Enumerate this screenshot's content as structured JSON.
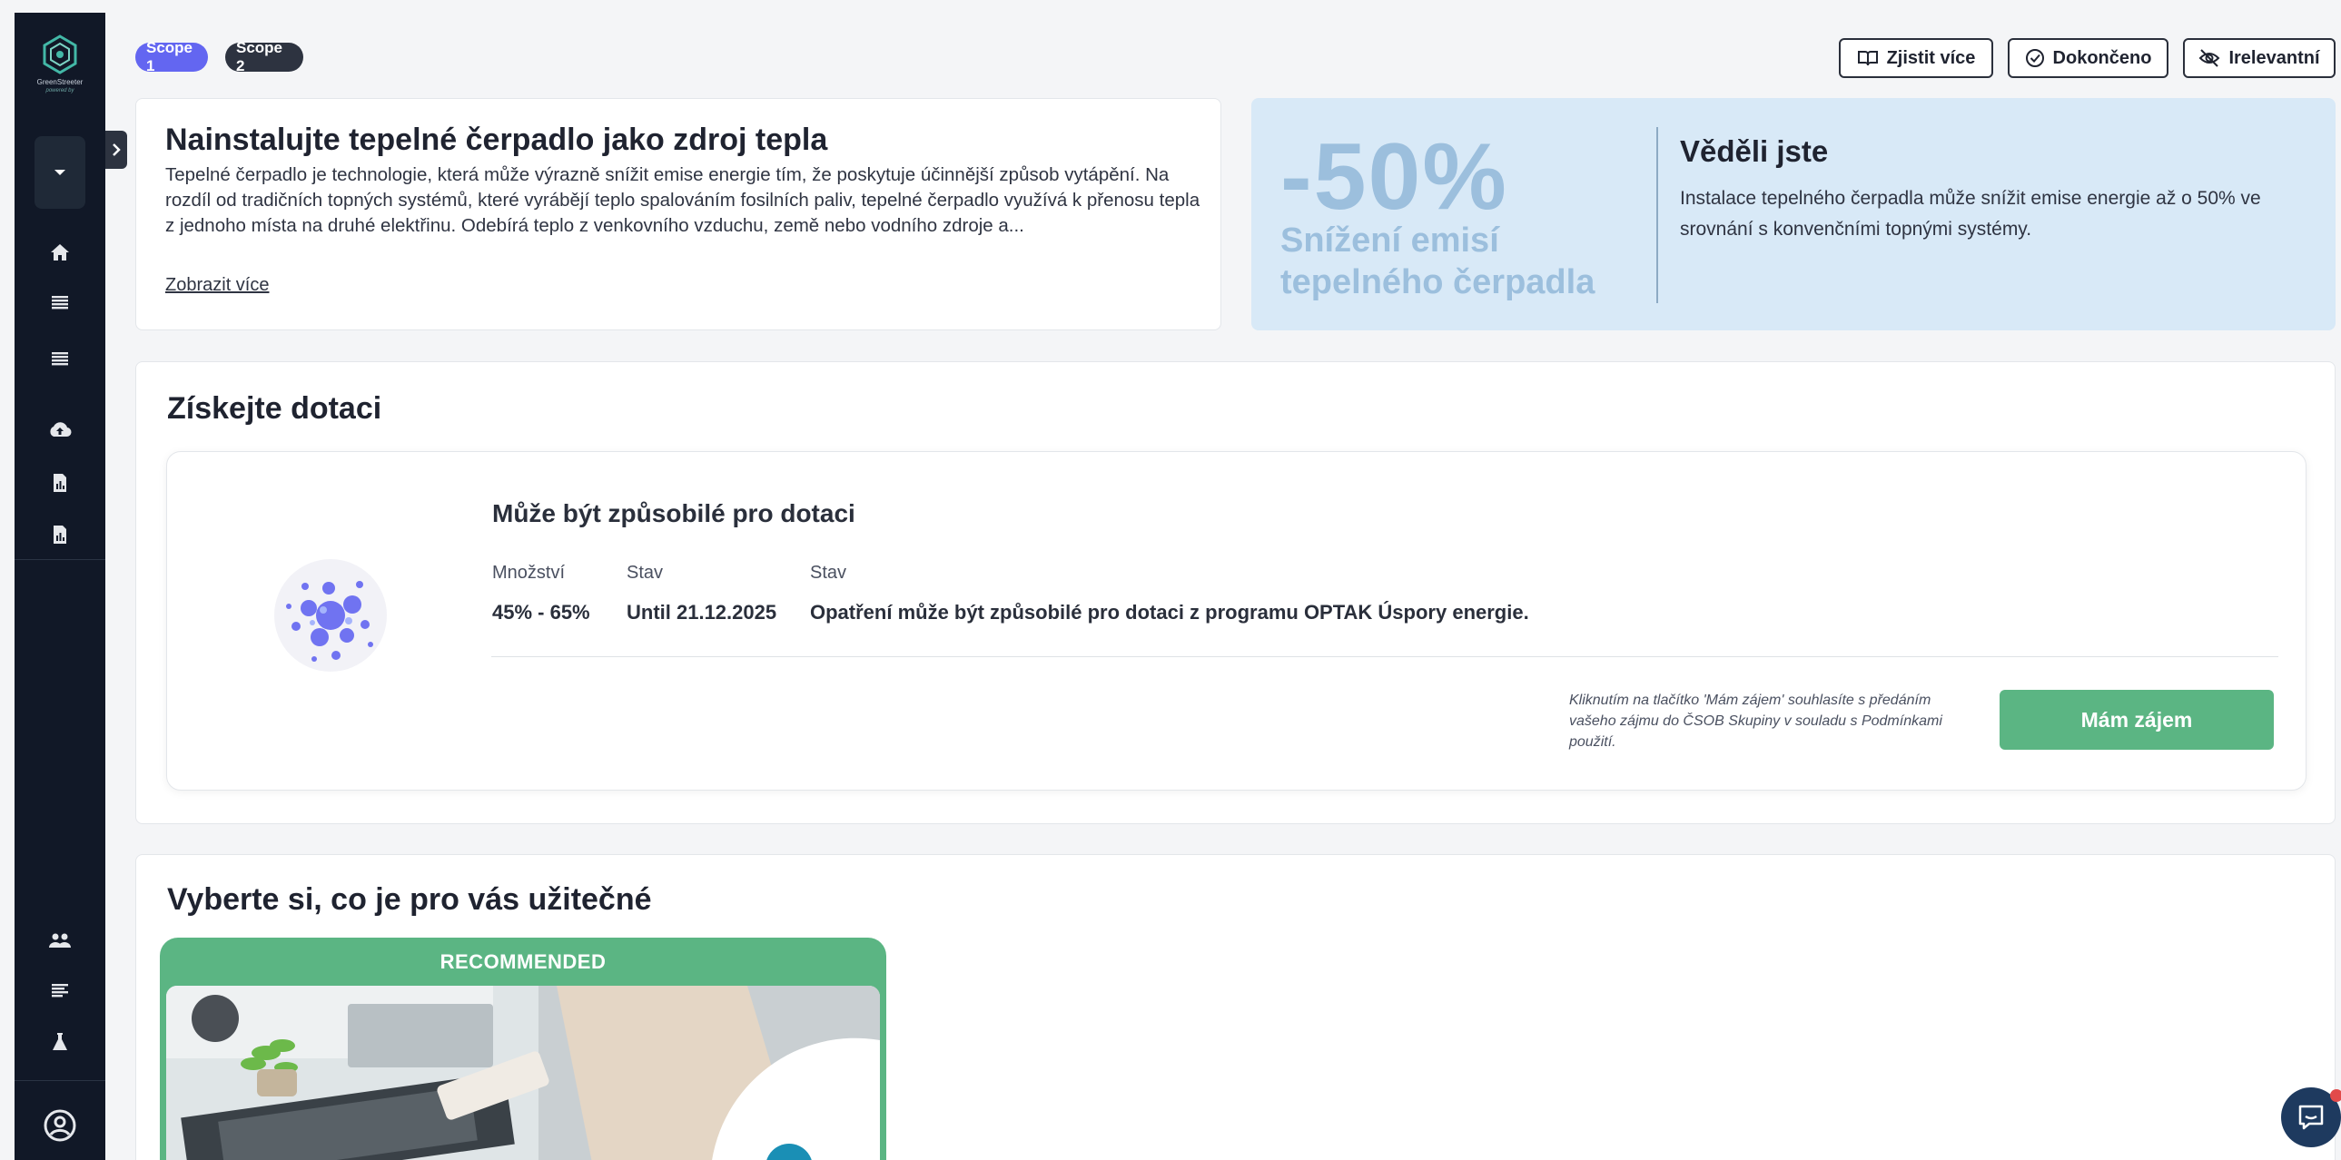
{
  "sidebar": {
    "logo_text": "GreenStreeter",
    "logo_sub": "powered by",
    "icons": [
      "home-icon",
      "list-icon",
      "list-icon",
      "cloud-upload-icon",
      "report-icon",
      "report-icon",
      "people-icon",
      "notes-icon",
      "flask-icon",
      "user-circle-icon"
    ]
  },
  "header": {
    "scopes": [
      "Scope 1",
      "Scope 2"
    ],
    "buttons": {
      "learn_more": "Zjistit více",
      "done": "Dokončeno",
      "irrelevant": "Irelevantní"
    }
  },
  "info": {
    "title": "Nainstalujte tepelné čerpadlo jako zdroj tepla",
    "description": "Tepelné čerpadlo je technologie, která může výrazně snížit emise energie tím, že poskytuje účinnější způsob vytápění. Na rozdíl od tradičních topných systémů, které vyrábějí teplo spalováním fosilních paliv, tepelné čerpadlo využívá k přenosu tepla z jednoho místa na druhé elektřinu. Odebírá teplo z venkovního vzduchu, země nebo vodního zdroje a...",
    "show_more": "Zobrazit více"
  },
  "fact": {
    "big_value": "-50%",
    "subtitle": "Snížení emisí tepelného čerpadla",
    "title": "Věděli jste",
    "text": "Instalace tepelného čerpadla může snížit emise energie až o 50% ve srovnání s konvenčními topnými systémy."
  },
  "grant": {
    "section_title": "Získejte dotaci",
    "title": "Může být způsobilé pro dotaci",
    "columns": [
      {
        "label": "Množství",
        "value": "45% - 65%"
      },
      {
        "label": "Stav",
        "value": "Until 21.12.2025"
      },
      {
        "label": "Stav",
        "value": "Opatření může být způsobilé pro dotaci z programu OPTAK Úspory energie."
      }
    ],
    "note": "Kliknutím na tlačítko 'Mám zájem' souhlasíte s předáním vašeho zájmu do ČSOB Skupiny v souladu s Podmínkami použití.",
    "button": "Mám zájem"
  },
  "useful": {
    "section_title": "Vyberte si, co je pro vás užitečné",
    "badge": "RECOMMENDED"
  },
  "colors": {
    "sidebar": "#111827",
    "scope1": "#6366f1",
    "scope2": "#2d3340",
    "accent_green": "#5bb583",
    "fact_bg": "#d8e9f7",
    "fact_text": "#9cbfdd"
  }
}
